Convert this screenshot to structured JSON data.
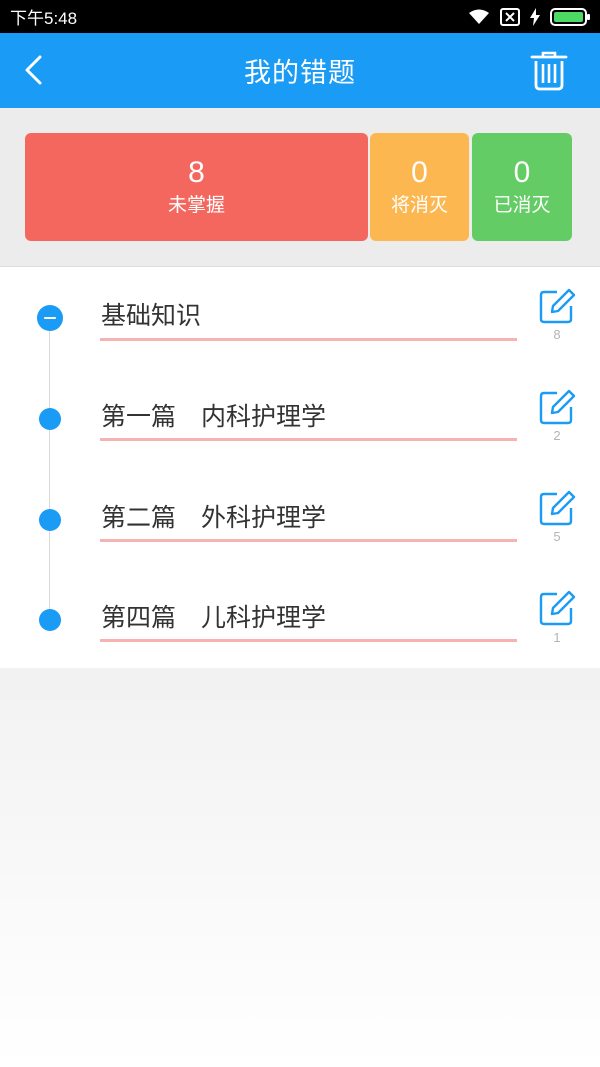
{
  "status_bar": {
    "time": "下午5:48"
  },
  "header": {
    "title": "我的错题"
  },
  "stats": [
    {
      "value": "8",
      "label": "未掌握",
      "color": "#f4675e"
    },
    {
      "value": "0",
      "label": "将消灭",
      "color": "#fdb750"
    },
    {
      "value": "0",
      "label": "已消灭",
      "color": "#63cc64"
    }
  ],
  "chapters": [
    {
      "title": "基础知识",
      "count": "8"
    },
    {
      "title": "第一篇　内科护理学",
      "count": "2"
    },
    {
      "title": "第二篇　外科护理学",
      "count": "5"
    },
    {
      "title": "第四篇　儿科护理学",
      "count": "1"
    }
  ],
  "colors": {
    "accent": "#1a9bf5",
    "underline": "#f6b3b1"
  }
}
